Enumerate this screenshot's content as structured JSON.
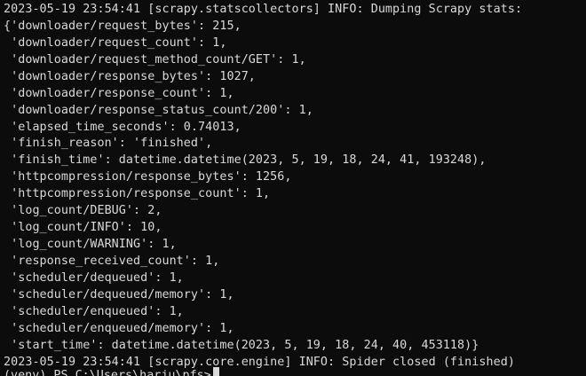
{
  "terminal": {
    "background": "#0c0c0c",
    "foreground": "#d9d9d9",
    "lines": [
      "2023-05-19 23:54:41 [scrapy.statscollectors] INFO: Dumping Scrapy stats:",
      "{'downloader/request_bytes': 215,",
      " 'downloader/request_count': 1,",
      " 'downloader/request_method_count/GET': 1,",
      " 'downloader/response_bytes': 1027,",
      " 'downloader/response_count': 1,",
      " 'downloader/response_status_count/200': 1,",
      " 'elapsed_time_seconds': 0.74013,",
      " 'finish_reason': 'finished',",
      " 'finish_time': datetime.datetime(2023, 5, 19, 18, 24, 41, 193248),",
      " 'httpcompression/response_bytes': 1256,",
      " 'httpcompression/response_count': 1,",
      " 'log_count/DEBUG': 2,",
      " 'log_count/INFO': 10,",
      " 'log_count/WARNING': 1,",
      " 'response_received_count': 1,",
      " 'scheduler/dequeued': 1,",
      " 'scheduler/dequeued/memory': 1,",
      " 'scheduler/enqueued': 1,",
      " 'scheduler/enqueued/memory': 1,",
      " 'start_time': datetime.datetime(2023, 5, 19, 18, 24, 40, 453118)}",
      "2023-05-19 23:54:41 [scrapy.core.engine] INFO: Spider closed (finished)"
    ],
    "prompt": "(venv) PS C:\\Users\\harju\\pfs>"
  }
}
